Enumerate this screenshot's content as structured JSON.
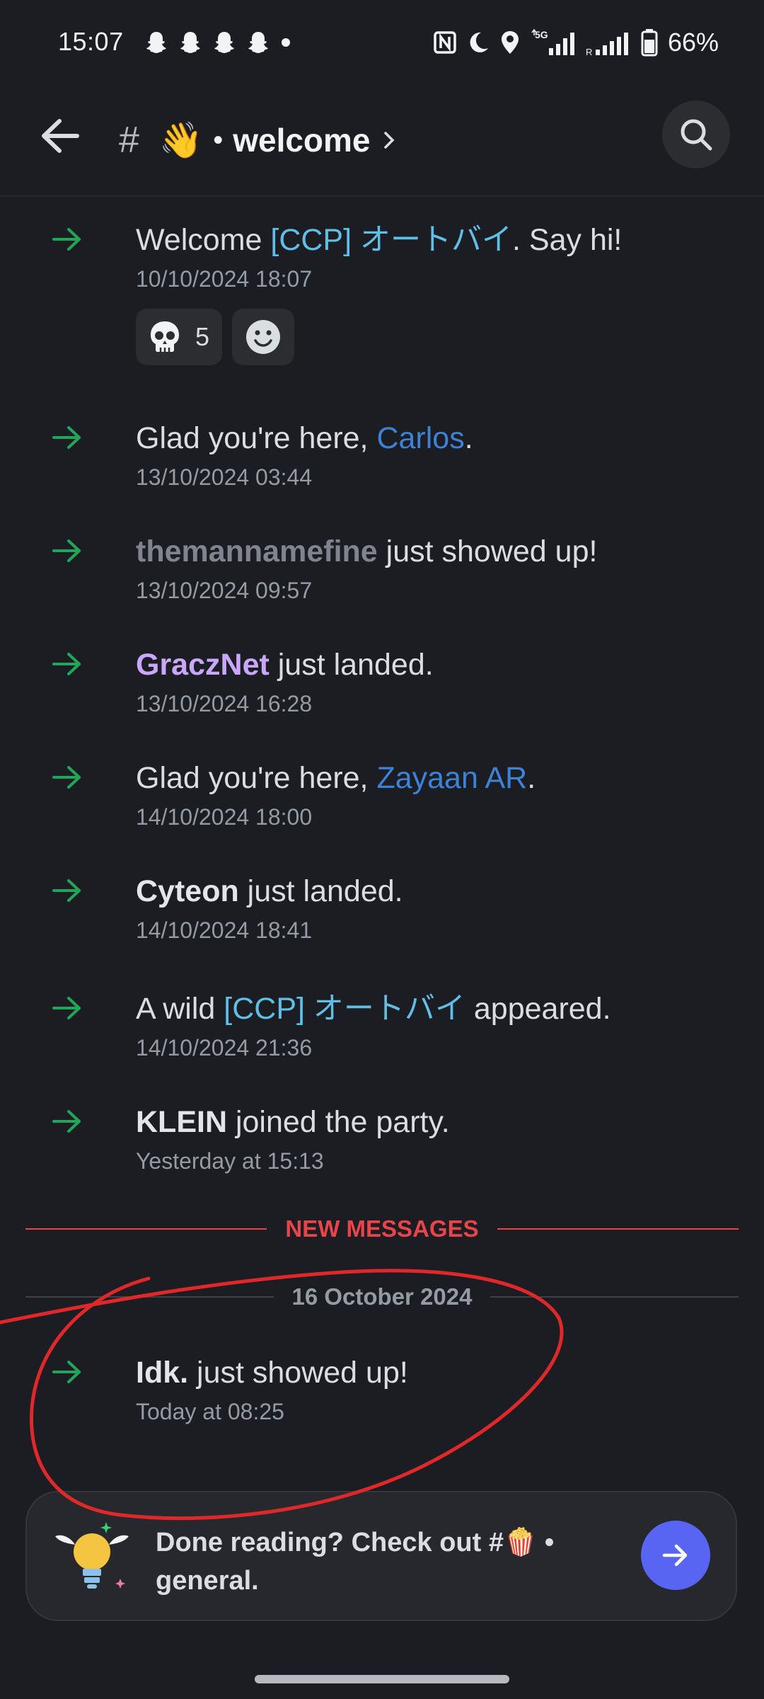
{
  "status_bar": {
    "time": "15:07",
    "battery": "66%",
    "notification_icons": [
      "snapchat-icon",
      "snapchat-icon",
      "snapchat-icon",
      "snapchat-icon",
      "more-dot-icon"
    ],
    "system_icons": [
      "nfc-icon",
      "moon-icon",
      "location-icon",
      "5g-signal-icon",
      "signal-icon",
      "battery-icon"
    ]
  },
  "header": {
    "hash": "#",
    "emoji": "👋",
    "separator": "•",
    "channel_name": "welcome"
  },
  "messages": [
    {
      "prefix": "Welcome ",
      "user": "[CCP] オートバイ",
      "suffix": ". Say hi!",
      "time": "10/10/2024 18:07"
    },
    {
      "prefix": "Glad you're here, ",
      "user": "Carlos",
      "suffix": ".",
      "time": "13/10/2024 03:44"
    },
    {
      "prefix": "",
      "user": "themannamefine",
      "suffix": " just showed up!",
      "time": "13/10/2024 09:57"
    },
    {
      "prefix": "",
      "user": "GraczNet",
      "suffix": " just landed.",
      "time": "13/10/2024 16:28"
    },
    {
      "prefix": "Glad you're here, ",
      "user": "Zayaan AR",
      "suffix": ".",
      "time": "14/10/2024 18:00"
    },
    {
      "prefix": "",
      "user": "Cyteon",
      "suffix": " just landed.",
      "time": "14/10/2024 18:41"
    },
    {
      "prefix": "A wild ",
      "user": "[CCP] オートバイ",
      "suffix": " appeared.",
      "time": "14/10/2024 21:36"
    },
    {
      "prefix": "",
      "user": "KLEIN",
      "suffix": " joined the party.",
      "time": "Yesterday at 15:13"
    },
    {
      "prefix": "",
      "user": "Idk.",
      "suffix": " just showed up!",
      "time": "Today at 08:25"
    }
  ],
  "reactions": [
    {
      "icon": "skull-icon",
      "count": "5"
    },
    {
      "icon": "add-reaction-icon",
      "count": ""
    }
  ],
  "dividers": {
    "new_messages": "NEW MESSAGES",
    "date": "16 October 2024"
  },
  "prompt": {
    "line1": "Done reading? Check out #🍿 •",
    "line2": "general."
  },
  "colors": {
    "background": "#1c1d22",
    "new_messages": "#e8454b",
    "join_arrow": "#23a559",
    "send_button": "#5865f2",
    "annotation_circle": "#e0282a"
  }
}
